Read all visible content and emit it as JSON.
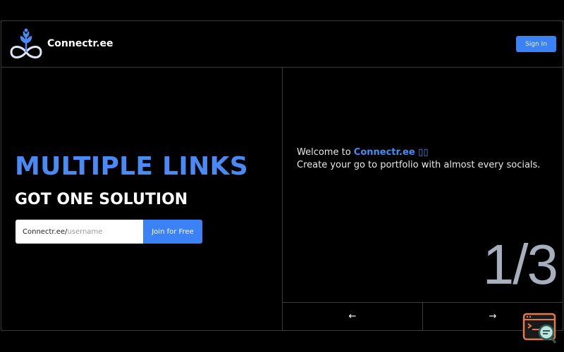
{
  "header": {
    "brand_name": "Connectr.ee",
    "signin_label": "Sign In",
    "logo_icon": "infinity-plant-logo"
  },
  "hero": {
    "headline": "MULTIPLE LINKS",
    "subheadline": "GOT ONE SOLUTION",
    "url_prefix": "Connectr.ee/",
    "username_placeholder": "username",
    "join_label": "Join for Free"
  },
  "slider": {
    "welcome_prefix": "Welcome to ",
    "welcome_brand": "Connectr.ee",
    "welcome_suffix": " ▯▯",
    "description": "Create your go to portfolio with almost every socials.",
    "counter": "1/3",
    "prev_icon": "←",
    "next_icon": "→"
  },
  "colors": {
    "accent": "#3b82f6",
    "accent_text": "#4a8af4",
    "counter": "#a7afbd",
    "background": "#000000",
    "border": "#3a3a3a"
  }
}
